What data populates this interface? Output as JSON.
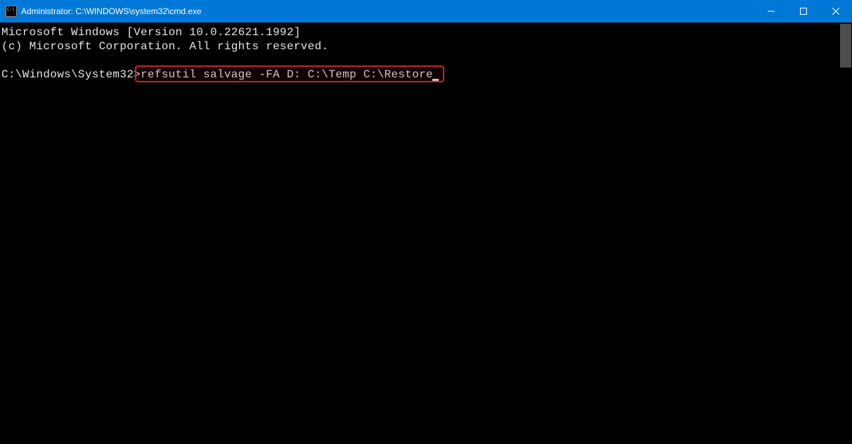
{
  "titlebar": {
    "title": "Administrator: C:\\WINDOWS\\system32\\cmd.exe"
  },
  "terminal": {
    "line1": "Microsoft Windows [Version 10.0.22621.1992]",
    "line2": "(c) Microsoft Corporation. All rights reserved.",
    "prompt": "C:\\Windows\\System32>",
    "command": "refsutil salvage -FA D: C:\\Temp C:\\Restore"
  }
}
